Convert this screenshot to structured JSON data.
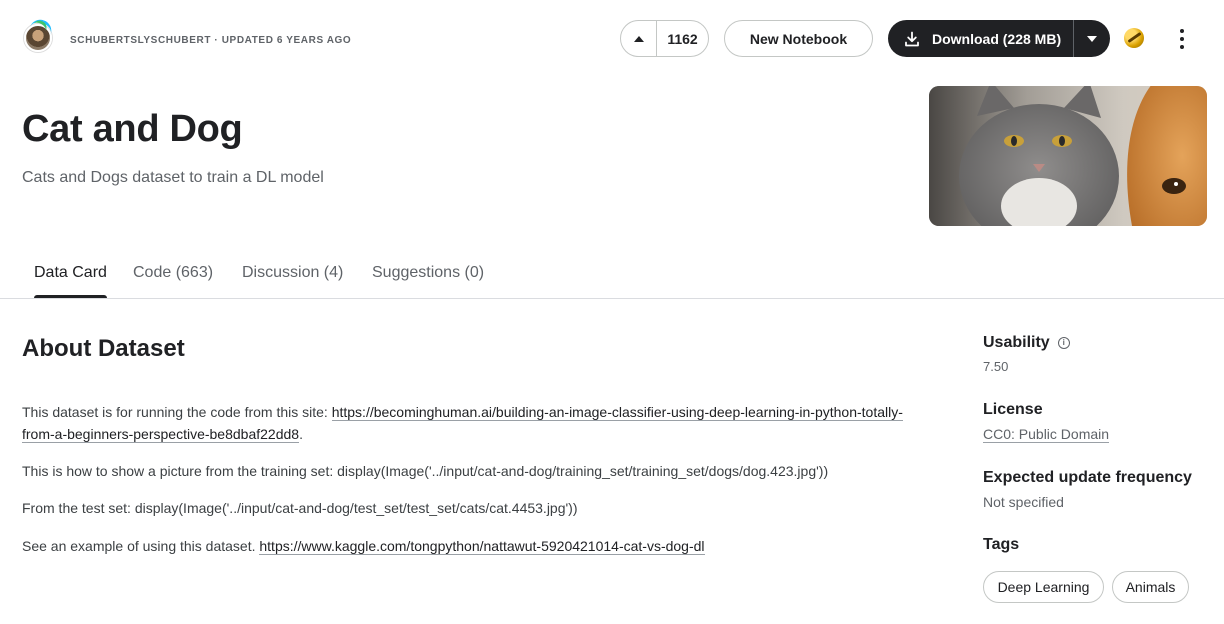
{
  "owner": {
    "meta": "SCHUBERTSLYSCHUBERT · UPDATED 6 YEARS AGO"
  },
  "toolbar": {
    "vote_count": "1162",
    "new_notebook_label": "New Notebook",
    "download_label": "Download (228 MB)"
  },
  "dataset": {
    "title": "Cat and Dog",
    "subtitle": "Cats and Dogs dataset to train a DL model"
  },
  "tabs": [
    {
      "label": "Data Card",
      "active": true
    },
    {
      "label": "Code (663)"
    },
    {
      "label": "Discussion (4)"
    },
    {
      "label": "Suggestions (0)"
    }
  ],
  "about": {
    "heading": "About Dataset",
    "p1_text": "This dataset is for running the code from this site: ",
    "p1_link": "https://becominghuman.ai/building-an-image-classifier-using-deep-learning-in-python-totally-from-a-beginners-perspective-be8dbaf22dd8",
    "p1_end": ".",
    "p2": "This is how to show a picture from the training set: display(Image('../input/cat-and-dog/training_set/training_set/dogs/dog.423.jpg'))",
    "p3": "From the test set: display(Image('../input/cat-and-dog/test_set/test_set/cats/cat.4453.jpg'))",
    "p4_text": "See an example of using this dataset. ",
    "p4_link": "https://www.kaggle.com/tongpython/nattawut-5920421014-cat-vs-dog-dl"
  },
  "sidebar": {
    "usability_label": "Usability",
    "usability_value": "7.50",
    "license_label": "License",
    "license_value": "CC0: Public Domain",
    "frequency_label": "Expected update frequency",
    "frequency_value": "Not specified",
    "tags_label": "Tags",
    "tags": [
      "Deep Learning",
      "Animals"
    ]
  },
  "colors": {
    "primary_dark": "#202124",
    "secondary_text": "#5f6368",
    "border": "#dadce0"
  },
  "icons": {
    "vote": "chevron-up-icon",
    "download": "download-icon",
    "caret": "caret-down-icon",
    "menu": "more-vert-icon",
    "info": "info-icon"
  }
}
